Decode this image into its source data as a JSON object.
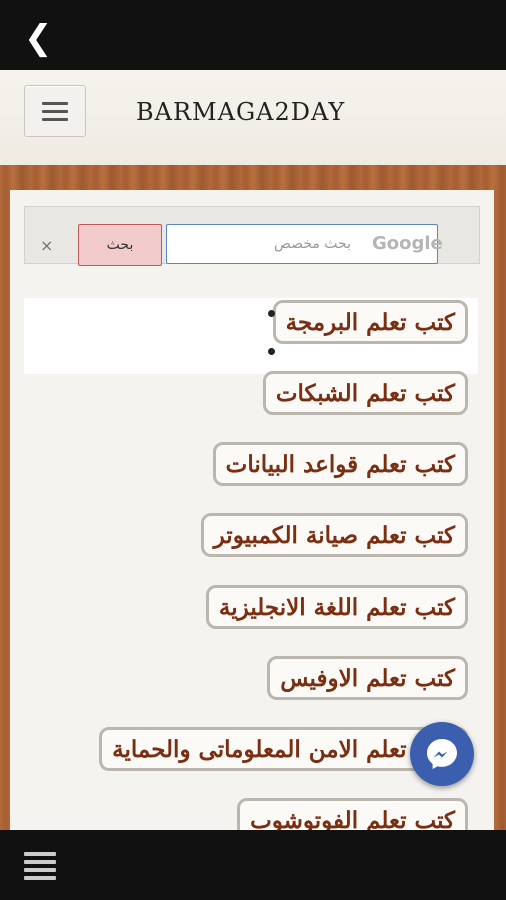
{
  "nav": {
    "back_icon": "chevron-left-icon"
  },
  "header": {
    "title": "BARMAGA2DAY",
    "menu_icon": "hamburger-icon"
  },
  "search": {
    "clear_label": "×",
    "button_label": "بحث",
    "placeholder": "بحث مخصص",
    "brand": "Google"
  },
  "categories": [
    {
      "label": "كتب تعلم البرمجة"
    },
    {
      "label": "كتب تعلم الشبكات"
    },
    {
      "label": "كتب تعلم قواعد البيانات"
    },
    {
      "label": "كتب تعلم صيانة الكمبيوتر"
    },
    {
      "label": "كتب تعلم اللغة الانجليزية"
    },
    {
      "label": "كتب تعلم الاوفيس"
    },
    {
      "label": "كتب تعلم الامن المعلوماتى والحماية"
    },
    {
      "label": "كتب تعلم الفوتوشوب"
    }
  ],
  "fab": {
    "icon": "messenger-icon"
  },
  "bottom": {
    "menu_icon": "menu-lines-icon"
  },
  "colors": {
    "accent": "#7a2e12",
    "fab": "#3b5fae",
    "search_button": "#f2cccc"
  }
}
